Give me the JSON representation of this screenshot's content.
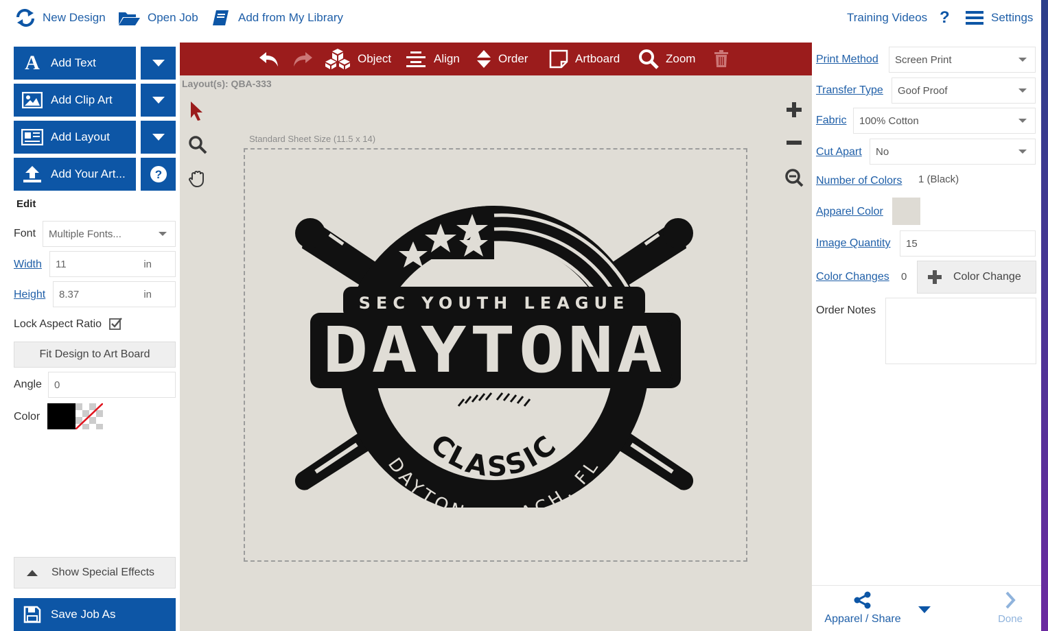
{
  "topbar": {
    "new_design": "New Design",
    "open_job": "Open Job",
    "add_library": "Add from My Library",
    "training_videos": "Training Videos",
    "help": "?",
    "settings": "Settings"
  },
  "left": {
    "add_text": "Add Text",
    "add_clip_art": "Add Clip Art",
    "add_layout": "Add Layout",
    "add_your_art": "Add Your Art...",
    "edit_title": "Edit",
    "font_label": "Font",
    "font_value": "Multiple Fonts...",
    "width_label": "Width",
    "width_value": "11",
    "width_unit": "in",
    "height_label": "Height",
    "height_value": "8.37",
    "height_unit": "in",
    "lock_label": "Lock Aspect Ratio",
    "fit_button": "Fit Design to Art Board",
    "angle_label": "Angle",
    "angle_value": "0",
    "color_label": "Color",
    "color_swatch": "#000000",
    "special_effects": "Show Special Effects",
    "save_job": "Save Job As"
  },
  "toolbar": {
    "object": "Object",
    "align": "Align",
    "order": "Order",
    "artboard": "Artboard",
    "zoom": "Zoom"
  },
  "canvas": {
    "layout_label": "Layout(s): QBA-333",
    "sheet_size": "Standard Sheet Size (11.5 x 14)"
  },
  "design": {
    "league": "SEC YOUTH LEAGUE",
    "name": "DAYTONA",
    "classic": "CLASSIC",
    "location": "DAYTONA BEACH, FL"
  },
  "right": {
    "print_method_label": "Print Method",
    "print_method_value": "Screen Print",
    "transfer_type_label": "Transfer Type",
    "transfer_type_value": "Goof Proof",
    "fabric_label": "Fabric",
    "fabric_value": "100% Cotton",
    "cut_apart_label": "Cut Apart",
    "cut_apart_value": "No",
    "num_colors_label": "Number of Colors",
    "num_colors_value": "1 (Black)",
    "apparel_color_label": "Apparel Color",
    "apparel_color_swatch": "#dedbd4",
    "image_qty_label": "Image Quantity",
    "image_qty_value": "15",
    "color_changes_label": "Color Changes",
    "color_changes_value": "0",
    "color_change_button": "Color Change",
    "order_notes_label": "Order Notes",
    "apparel_share": "Apparel / Share",
    "done": "Done"
  },
  "colors": {
    "brand_blue": "#0d56a6",
    "toolbar_red": "#9b1c1c",
    "canvas_bg": "#e0ddd6"
  }
}
